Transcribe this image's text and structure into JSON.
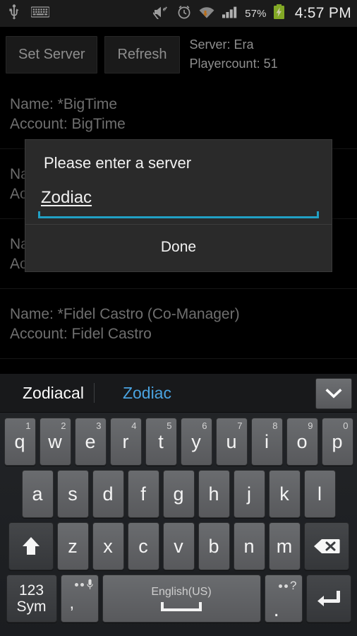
{
  "status_bar": {
    "time": "4:57 PM",
    "battery_percent": "57%",
    "icons": [
      "usb-icon",
      "keyboard-icon",
      "mute-icon",
      "alarm-icon",
      "wifi-download-icon",
      "signal-icon",
      "battery-charging-icon"
    ]
  },
  "toolbar": {
    "set_server_label": "Set Server",
    "refresh_label": "Refresh",
    "server_line": "Server: Era",
    "playercount_line": "Playercount: 51"
  },
  "list": {
    "rows": [
      {
        "name": "Name: *BigTime",
        "account": "Account: BigTime"
      },
      {
        "name": "Name: *Unknown",
        "account": "Account: Unknown"
      },
      {
        "name": "Name: *Fidel Castro",
        "account": "Account: Fidel Castro"
      },
      {
        "name": "Name: *Fidel Castro (Co-Manager)",
        "account": "Account: Fidel Castro"
      }
    ]
  },
  "dialog": {
    "title": "Please enter a server",
    "input_value": "Zodiac",
    "input_placeholder": "",
    "done_label": "Done",
    "accent_color": "#21a0c4"
  },
  "keyboard": {
    "suggestions": {
      "first": "Zodiacal",
      "second": "Zodiac",
      "highlight_color": "#4aa3e0"
    },
    "row1": [
      {
        "letter": "q",
        "number": "1"
      },
      {
        "letter": "w",
        "number": "2"
      },
      {
        "letter": "e",
        "number": "3"
      },
      {
        "letter": "r",
        "number": "4"
      },
      {
        "letter": "t",
        "number": "5"
      },
      {
        "letter": "y",
        "number": "6"
      },
      {
        "letter": "u",
        "number": "7"
      },
      {
        "letter": "i",
        "number": "8"
      },
      {
        "letter": "o",
        "number": "9"
      },
      {
        "letter": "p",
        "number": "0"
      }
    ],
    "row2": [
      "a",
      "s",
      "d",
      "f",
      "g",
      "h",
      "j",
      "k",
      "l"
    ],
    "row3": [
      "z",
      "x",
      "c",
      "v",
      "b",
      "n",
      "m"
    ],
    "shift_key": "shift-icon",
    "backspace_key": "backspace-icon",
    "sym_line1": "123",
    "sym_line2": "Sym",
    "comma_key": ",",
    "mic_key": "microphone-icon",
    "space_label": "English(US)",
    "period_key": ".",
    "period_alt": "?",
    "enter_key": "enter-icon"
  }
}
